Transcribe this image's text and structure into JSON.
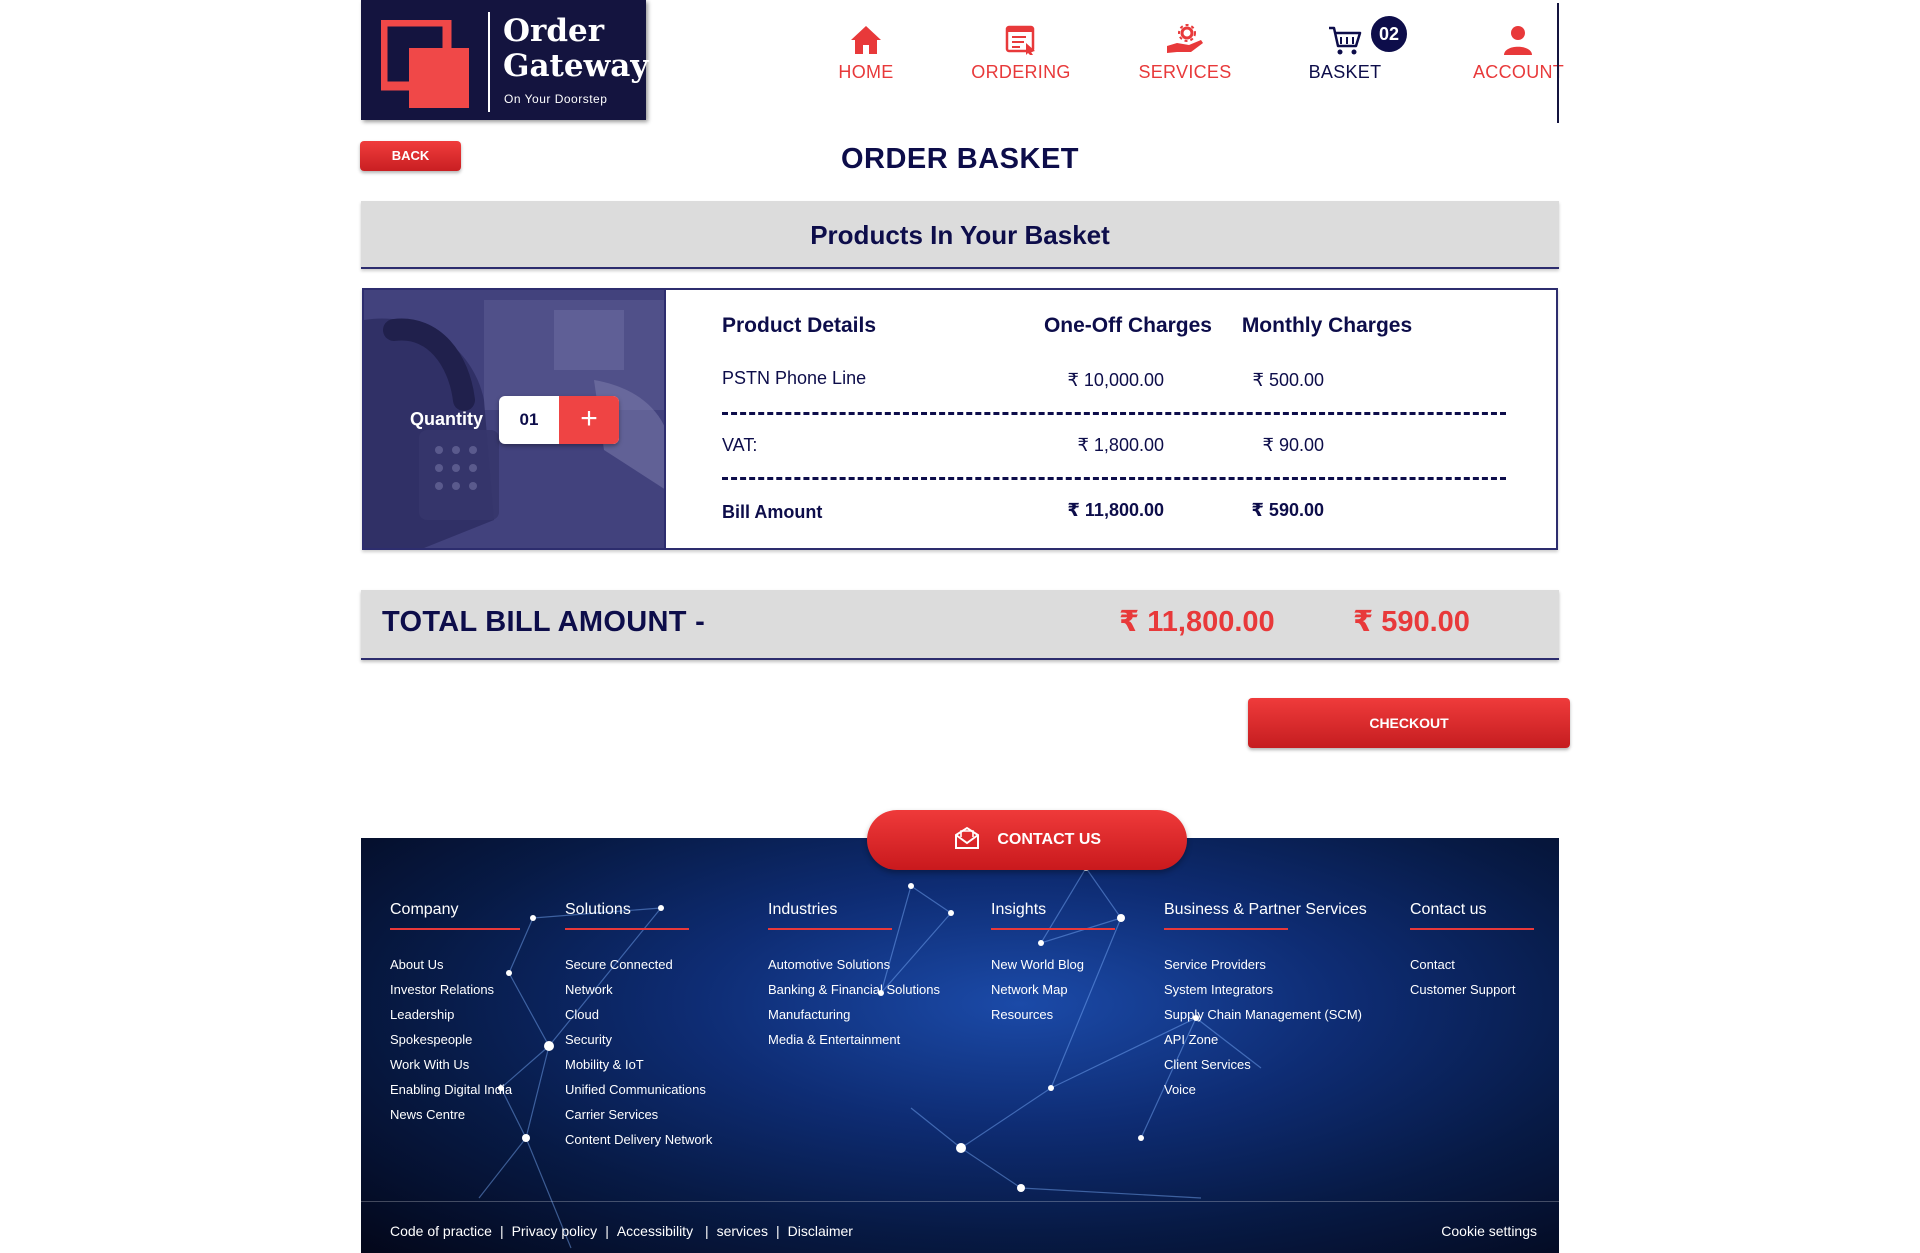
{
  "header": {
    "logo": {
      "title_line1": "Order",
      "title_line2": "Gateway",
      "tagline": "On Your Doorstep"
    },
    "nav": [
      {
        "label": "HOME",
        "icon": "home-icon"
      },
      {
        "label": "ORDERING",
        "icon": "ordering-icon"
      },
      {
        "label": "SERVICES",
        "icon": "services-icon"
      },
      {
        "label": "BASKET",
        "icon": "cart-icon",
        "badge": "02"
      },
      {
        "label": "ACCOUNT",
        "icon": "user-icon"
      }
    ]
  },
  "back_label": "BACK",
  "page_title": "ORDER BASKET",
  "section_title": "Products In Your Basket",
  "basket": {
    "quantity_label": "Quantity",
    "quantity_value": "01",
    "plus_label": "+",
    "headers": {
      "product": "Product Details",
      "one_off": "One-Off Charges",
      "monthly": "Monthly Charges"
    },
    "rows": [
      {
        "label": "PSTN Phone Line",
        "one_off": "₹ 10,000.00",
        "monthly": "₹ 500.00"
      },
      {
        "label": "VAT:",
        "one_off": "₹ 1,800.00",
        "monthly": "₹ 90.00"
      },
      {
        "label": "Bill Amount",
        "one_off": "₹ 11,800.00",
        "monthly": "₹ 590.00"
      }
    ]
  },
  "total": {
    "label": "TOTAL BILL AMOUNT -",
    "one_off": "₹ 11,800.00",
    "monthly": "₹ 590.00"
  },
  "checkout_label": "CHECKOUT",
  "contact_label": "CONTACT US",
  "footer": {
    "columns": [
      {
        "title": "Company",
        "items": [
          "About Us",
          "Investor Relations",
          "Leadership",
          "Spokespeople",
          "Work With Us",
          "Enabling Digital India",
          "News Centre"
        ]
      },
      {
        "title": "Solutions",
        "items": [
          "Secure Connected",
          "Network",
          "Cloud",
          "Security",
          "Mobility & IoT",
          "Unified Communications",
          "Carrier Services",
          "Content Delivery Network"
        ]
      },
      {
        "title": "Industries",
        "items": [
          "Automotive Solutions",
          "Banking & Financial Solutions",
          "Manufacturing",
          "Media & Entertainment"
        ]
      },
      {
        "title": "Insights",
        "items": [
          "New World Blog",
          "Network Map",
          "Resources"
        ]
      },
      {
        "title": "Business & Partner Services",
        "items": [
          "Service Providers",
          "System Integrators",
          "Supply Chain Management (SCM)",
          "API Zone",
          "Client Services",
          "Voice"
        ]
      },
      {
        "title": "Contact us",
        "items": [
          "Contact",
          "Customer Support"
        ]
      }
    ],
    "legal": [
      "Code of practice",
      "Privacy policy",
      "Accessibility",
      "services",
      "Disclaimer"
    ],
    "cookie": "Cookie settings"
  },
  "colors": {
    "navy": "#0d0d4a",
    "accent_red": "#e8393a",
    "panel_grey": "#dcdcdc"
  }
}
